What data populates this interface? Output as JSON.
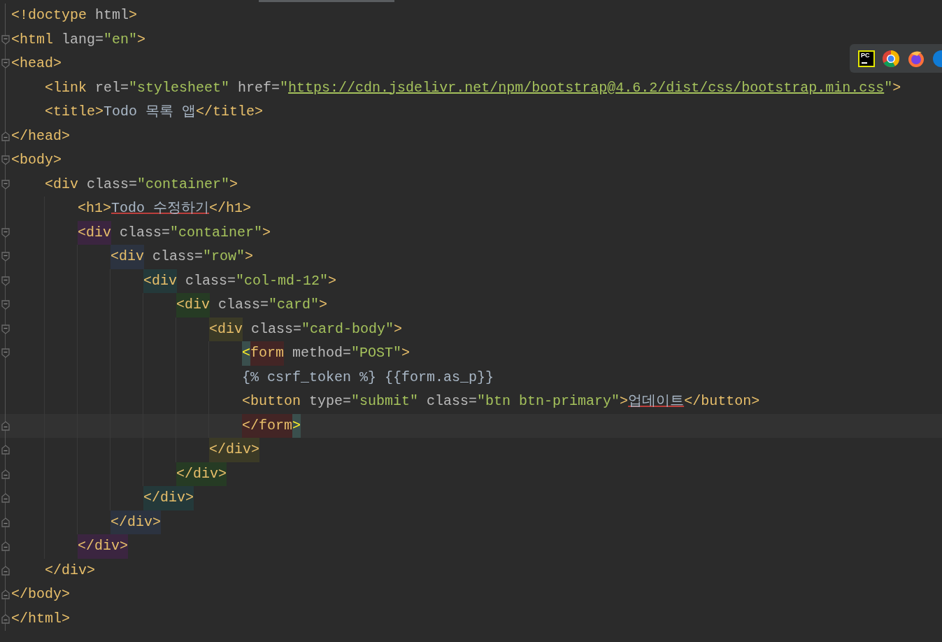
{
  "editor": {
    "lines": [
      {
        "kind": "plain",
        "tokens": [
          {
            "kind": "tag",
            "text": "<!doctype"
          },
          {
            "kind": "attr",
            "text": " html"
          },
          {
            "kind": "tag",
            "text": ">"
          }
        ]
      },
      {
        "kind": "fold-start-flat",
        "tokens": [
          {
            "kind": "tag",
            "text": "<html"
          },
          {
            "kind": "attr",
            "text": " lang="
          },
          {
            "kind": "value",
            "text": "\"en\""
          },
          {
            "kind": "tag",
            "text": ">"
          }
        ]
      },
      {
        "kind": "fold-start",
        "tokens": [
          {
            "kind": "tag",
            "text": "<head>"
          }
        ]
      },
      {
        "kind": "plain",
        "tokens": [
          {
            "kind": "tag",
            "text": "<link"
          },
          {
            "kind": "attr",
            "text": " rel="
          },
          {
            "kind": "value",
            "text": "\"stylesheet\""
          },
          {
            "kind": "attr",
            "text": " href="
          },
          {
            "kind": "value",
            "text": "\""
          },
          {
            "kind": "url",
            "text": "https://cdn.jsdelivr.net/npm/bootstrap@4.6.2/dist/css/bootstrap.min.css"
          },
          {
            "kind": "value",
            "text": "\""
          },
          {
            "kind": "tag",
            "text": ">"
          }
        ]
      },
      {
        "kind": "plain",
        "tokens": [
          {
            "kind": "tag",
            "text": "<title>"
          },
          {
            "kind": "text",
            "text": "Todo 목록 앱"
          },
          {
            "kind": "tag",
            "text": "</title>"
          }
        ]
      },
      {
        "kind": "fold-end",
        "tokens": [
          {
            "kind": "tag",
            "text": "</head>"
          }
        ]
      },
      {
        "kind": "fold-start",
        "tokens": [
          {
            "kind": "tag",
            "text": "<body>"
          }
        ]
      },
      {
        "kind": "fold-start",
        "tokens": [
          {
            "kind": "tag",
            "text": "<div"
          },
          {
            "kind": "attr",
            "text": " class="
          },
          {
            "kind": "value",
            "text": "\"container\""
          },
          {
            "kind": "tag",
            "text": ">"
          }
        ]
      },
      {
        "kind": "plain",
        "tokens": [
          {
            "kind": "tag",
            "text": "<h1>"
          },
          {
            "kind": "typo",
            "text": "Todo 수정하기"
          },
          {
            "kind": "tag",
            "text": "</h1>"
          }
        ]
      },
      {
        "kind": "fold-start",
        "tokens": [
          {
            "kind": "tag",
            "text": "<div",
            "color": "#3b2540"
          },
          {
            "kind": "attr",
            "text": " class="
          },
          {
            "kind": "value",
            "text": "\"container\""
          },
          {
            "kind": "tag",
            "text": ">"
          }
        ]
      },
      {
        "kind": "fold-start",
        "tokens": [
          {
            "kind": "tag",
            "text": "<div",
            "color": "#2c3340"
          },
          {
            "kind": "attr",
            "text": " class="
          },
          {
            "kind": "value",
            "text": "\"row\""
          },
          {
            "kind": "tag",
            "text": ">"
          }
        ]
      },
      {
        "kind": "fold-start",
        "tokens": [
          {
            "kind": "tag",
            "text": "<div",
            "color": "#24393a"
          },
          {
            "kind": "attr",
            "text": " class="
          },
          {
            "kind": "value",
            "text": "\"col-md-12\""
          },
          {
            "kind": "tag",
            "text": ">"
          }
        ]
      },
      {
        "kind": "fold-start",
        "tokens": [
          {
            "kind": "tag",
            "text": "<div",
            "color": "#263b24"
          },
          {
            "kind": "attr",
            "text": " class="
          },
          {
            "kind": "value",
            "text": "\"card\""
          },
          {
            "kind": "tag",
            "text": ">"
          }
        ]
      },
      {
        "kind": "fold-start",
        "tokens": [
          {
            "kind": "tag",
            "text": "<div",
            "color": "#3b3a26"
          },
          {
            "kind": "attr",
            "text": " class="
          },
          {
            "kind": "value",
            "text": "\"card-body\""
          },
          {
            "kind": "tag",
            "text": ">"
          }
        ]
      },
      {
        "kind": "fold-start-flat",
        "tokens": [
          {
            "kind": "bracket",
            "text": "<",
            "color": "#3a4f4d"
          },
          {
            "kind": "tag",
            "text": "form",
            "color": "#432525"
          },
          {
            "kind": "attr",
            "text": " method="
          },
          {
            "kind": "value",
            "text": "\"POST\""
          },
          {
            "kind": "tag",
            "text": ">"
          }
        ]
      },
      {
        "kind": "plain",
        "tokens": [
          {
            "kind": "text",
            "text": "{% csrf_token %} {{form.as_p}}"
          }
        ]
      },
      {
        "kind": "plain",
        "tokens": [
          {
            "kind": "tag",
            "text": "<button"
          },
          {
            "kind": "attr",
            "text": " type="
          },
          {
            "kind": "value",
            "text": "\"submit\""
          },
          {
            "kind": "attr",
            "text": " class="
          },
          {
            "kind": "value",
            "text": "\"btn btn-primary\""
          },
          {
            "kind": "tag",
            "text": ">"
          },
          {
            "kind": "typo",
            "text": "업데이트"
          },
          {
            "kind": "tag",
            "text": "</button>"
          }
        ]
      },
      {
        "kind": "fold-end-flat",
        "current": true,
        "tokens": [
          {
            "kind": "tag",
            "text": "</form",
            "color": "#432525"
          },
          {
            "kind": "bracket",
            "text": ">",
            "color": "#3a4f4d"
          }
        ]
      },
      {
        "kind": "fold-end",
        "tokens": [
          {
            "kind": "tag",
            "text": "</div>",
            "color": "#3b3a26"
          }
        ]
      },
      {
        "kind": "fold-end",
        "tokens": [
          {
            "kind": "tag",
            "text": "</div>",
            "color": "#263b24"
          }
        ]
      },
      {
        "kind": "fold-end",
        "tokens": [
          {
            "kind": "tag",
            "text": "</div>",
            "color": "#24393a"
          }
        ]
      },
      {
        "kind": "fold-end",
        "tokens": [
          {
            "kind": "tag",
            "text": "</div>",
            "color": "#2c3340"
          }
        ]
      },
      {
        "kind": "fold-end",
        "tokens": [
          {
            "kind": "tag",
            "text": "</div>",
            "color": "#3b2540"
          }
        ]
      },
      {
        "kind": "fold-end",
        "tokens": [
          {
            "kind": "tag",
            "text": "</div>"
          }
        ]
      },
      {
        "kind": "fold-end",
        "tokens": [
          {
            "kind": "tag",
            "text": "</body>"
          }
        ]
      },
      {
        "kind": "fold-end-flat",
        "tokens": [
          {
            "kind": "tag",
            "text": "</html>"
          }
        ]
      }
    ]
  },
  "browser_toolbar": {
    "ide_icon_label": "PC"
  }
}
